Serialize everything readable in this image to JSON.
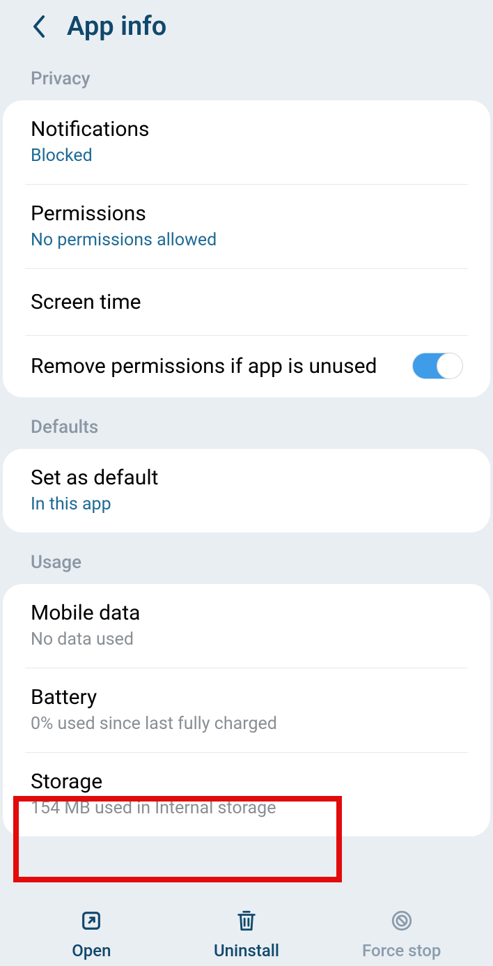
{
  "header": {
    "title": "App info"
  },
  "sections": {
    "privacy": {
      "label": "Privacy",
      "notifications": {
        "title": "Notifications",
        "subtitle": "Blocked"
      },
      "permissions": {
        "title": "Permissions",
        "subtitle": "No permissions allowed"
      },
      "screentime": {
        "title": "Screen time"
      },
      "removePermissions": {
        "title": "Remove permissions if app is unused",
        "enabled": true
      }
    },
    "defaults": {
      "label": "Defaults",
      "setDefault": {
        "title": "Set as default",
        "subtitle": "In this app"
      }
    },
    "usage": {
      "label": "Usage",
      "mobileData": {
        "title": "Mobile data",
        "subtitle": "No data used"
      },
      "battery": {
        "title": "Battery",
        "subtitle": "0% used since last fully charged"
      },
      "storage": {
        "title": "Storage",
        "subtitle": "154 MB used in Internal storage"
      }
    }
  },
  "bottomBar": {
    "open": "Open",
    "uninstall": "Uninstall",
    "forceStop": "Force stop"
  }
}
